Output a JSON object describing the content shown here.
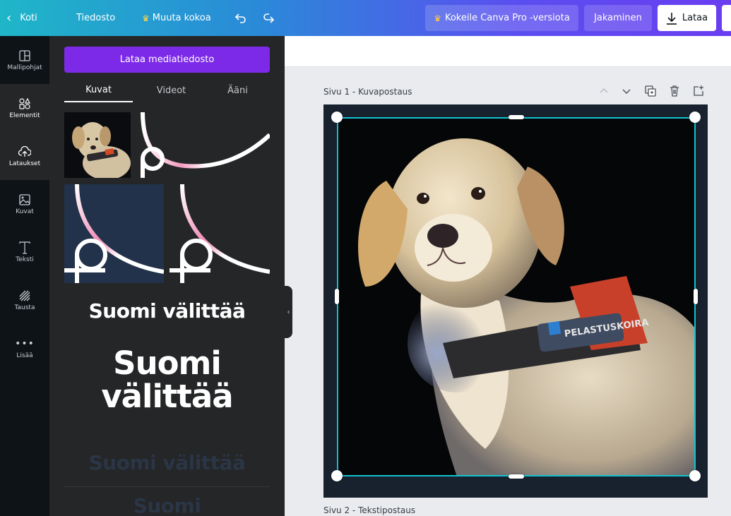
{
  "topbar": {
    "home_label": "Koti",
    "file_label": "Tiedosto",
    "resize_label": "Muuta kokoa",
    "pro_label": "Kokeile Canva Pro -versiota",
    "share_label": "Jakaminen",
    "download_label": "Lataa"
  },
  "rail": {
    "items": [
      {
        "label": "Mallipohjat"
      },
      {
        "label": "Elementit"
      },
      {
        "label": "Lataukset"
      },
      {
        "label": "Kuvat"
      },
      {
        "label": "Teksti"
      },
      {
        "label": "Tausta"
      },
      {
        "label": "Lisää"
      }
    ]
  },
  "panel": {
    "upload_button": "Lataa mediatiedosto",
    "tabs": [
      {
        "label": "Kuvat",
        "active": true
      },
      {
        "label": "Videot",
        "active": false
      },
      {
        "label": "Ääni",
        "active": false
      }
    ],
    "text_assets": [
      "Suomi välittää",
      "Suomi välittää",
      "Suomi välittää",
      "Suomi"
    ]
  },
  "editor": {
    "page1_label": "Sivu 1 - Kuvapostaus",
    "page2_label": "Sivu 2 - Tekstipostaus",
    "harness_text": "PELASTUSKOIRA"
  },
  "colors": {
    "accent": "#7d2ae8",
    "selection": "#12c1d0",
    "rail_bg": "#0e1318",
    "panel_bg": "#252627"
  }
}
